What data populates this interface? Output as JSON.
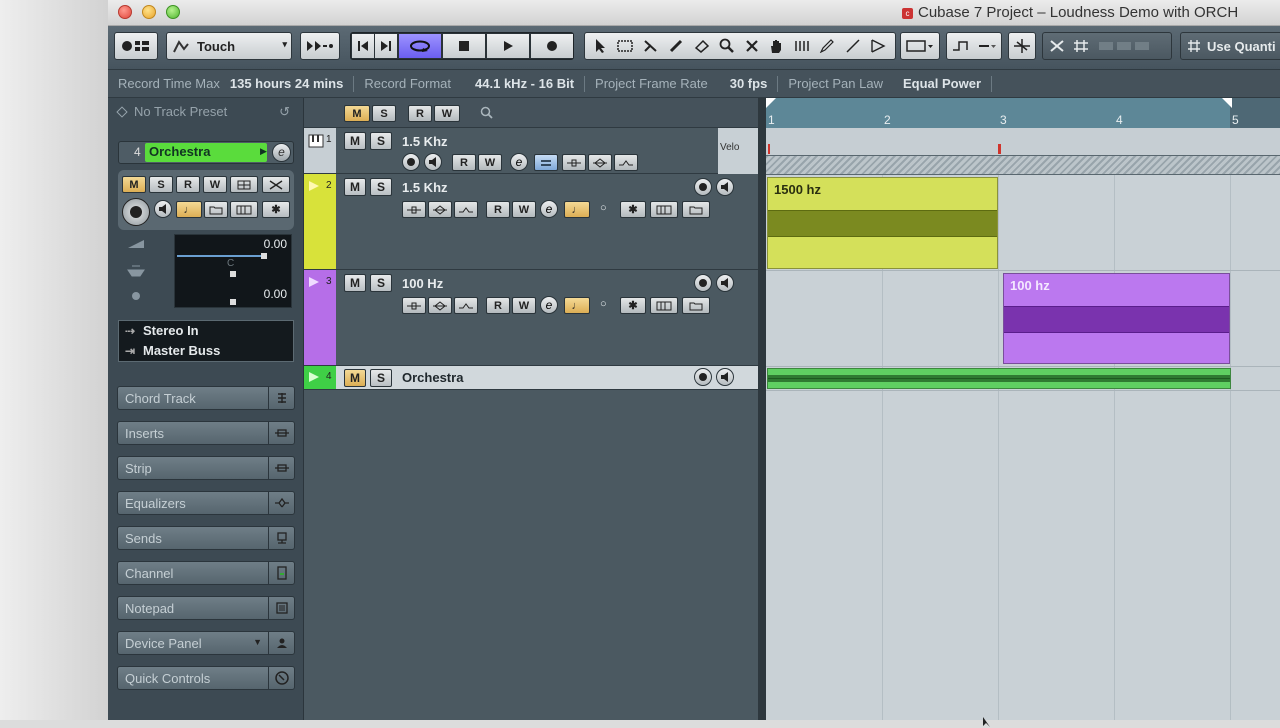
{
  "window": {
    "title": "Cubase 7 Project - Loudness Demo with ORCH",
    "title_display": "Cubase 7 Project – Loudness Demo with ORCH"
  },
  "toolbar": {
    "automation_mode": "Touch",
    "quantize_label": "Use Quanti"
  },
  "status": {
    "record_time_label": "Record Time Max",
    "record_time_value": "135 hours 24 mins",
    "record_format_label": "Record Format",
    "record_format_value": "44.1 kHz - 16 Bit",
    "frame_rate_label": "Project Frame Rate",
    "frame_rate_value": "30 fps",
    "pan_law_label": "Project Pan Law",
    "pan_law_value": "Equal Power"
  },
  "inspector": {
    "preset": "No Track Preset",
    "track_number": "4",
    "track_name": "Orchestra",
    "volume_value": "0.00",
    "pan_label": "C",
    "delay_value": "0.00",
    "input_routing": "Stereo In",
    "output_routing": "Master Buss",
    "sections": [
      "Chord Track",
      "Inserts",
      "Strip",
      "Equalizers",
      "Sends",
      "Channel",
      "Notepad",
      "Device Panel",
      "Quick Controls"
    ]
  },
  "track_header": {
    "m": "M",
    "s": "S",
    "r": "R",
    "w": "W"
  },
  "tracks": [
    {
      "number": "1",
      "name": "1.5 Khz",
      "type": "midi",
      "velo": "Velo"
    },
    {
      "number": "2",
      "name": "1.5 Khz",
      "type": "instrument",
      "color": "#d8e23a"
    },
    {
      "number": "3",
      "name": "100 Hz",
      "type": "instrument",
      "color": "#b66ee8"
    },
    {
      "number": "4",
      "name": "Orchestra",
      "type": "audio",
      "color": "#3fcf46"
    }
  ],
  "ruler": {
    "bars": [
      "1",
      "2",
      "3",
      "4",
      "5"
    ]
  },
  "parts": [
    {
      "name": "1500 hz",
      "track": "2",
      "color": "#d4e05a"
    },
    {
      "name": "100 hz",
      "track": "3",
      "color": "#bb78ef"
    },
    {
      "name": "",
      "track": "4",
      "color": "#5fcf62"
    }
  ],
  "colors": {
    "accent_blue": "#7b6cf0",
    "track_yellow": "#d8e23a",
    "track_purple": "#b66ee8",
    "track_green": "#3fcf46"
  }
}
